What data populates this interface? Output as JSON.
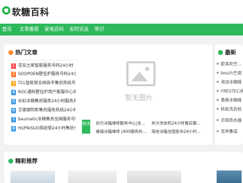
{
  "header": {
    "logo_text": "软糖百科",
    "brand_color": "#2eb85c",
    "logo_icon": "logo-leaf-icon"
  },
  "nav": {
    "items": [
      {
        "label": "首页"
      },
      {
        "label": "文章推荐"
      },
      {
        "label": "家电百科"
      },
      {
        "label": "实时讯息"
      },
      {
        "label": "常识"
      }
    ]
  },
  "hot": {
    "title": "热门文章",
    "icon": "flame-icon",
    "items": [
      {
        "num": "1",
        "text": "花安之家智能服务号码24小时"
      },
      {
        "num": "2",
        "text": "SOOPOEN壁挂炉服务号码24小"
      },
      {
        "num": "3",
        "text": "TCL智能锁全国各市售后热线号码"
      },
      {
        "num": "4",
        "text": "ROC通科壁挂炉用户客服中心实"
      },
      {
        "num": "5",
        "text": "长虹冰箱售后服务24小时服务热"
      },
      {
        "num": "6",
        "text": "艾德保险柜售后服务热线24小时"
      },
      {
        "num": "7",
        "text": "baumatic冰箱售后全国服务号码"
      },
      {
        "num": "8",
        "text": "HUPAISUO指纹锁24小时售后全"
      }
    ],
    "num_colors": [
      "#ff4d4f",
      "#ff7a2f",
      "#ffb02e",
      "#4aa0e6",
      "#4aa0e6",
      "#4aa0e6",
      "#4aa0e6",
      "#4aa0e6"
    ]
  },
  "placeholder": {
    "text": "暂无图片",
    "icon": "image-placeholder-icon"
  },
  "info": {
    "badge": "快讯",
    "items": [
      "劲力冰箱维修服务中心|全...",
      "米沙洗衣机24小时售后服...",
      "格瑞冰箱维修 [400服务热...",
      "海信冰箱全国各市24小时..."
    ]
  },
  "latest": {
    "title": "最新",
    "icon": "clock-icon",
    "items": [
      "欧诺尼空...",
      "bosch空调",
      "海派冰箱维",
      "FRESTEC冰",
      "惠景冰箱维",
      "科凯洗衣机",
      "贝田热水器",
      "百声集成"
    ]
  },
  "recommend": {
    "title": "精彩推荐",
    "icon": "star-icon"
  }
}
